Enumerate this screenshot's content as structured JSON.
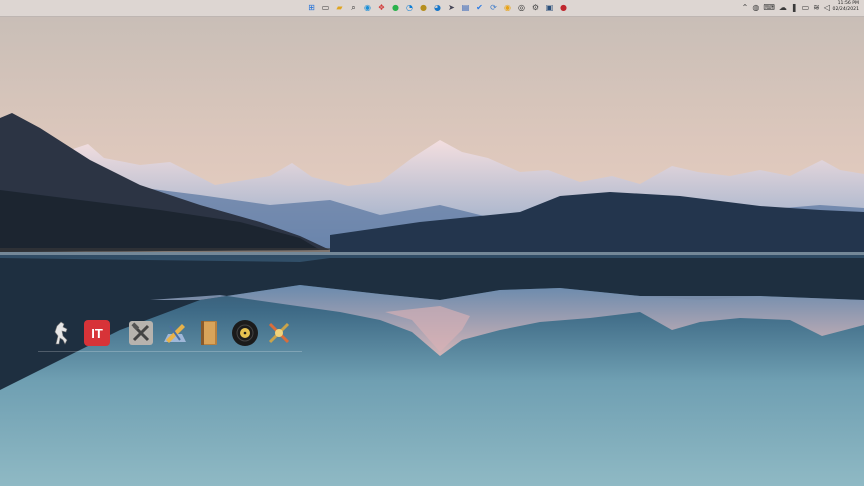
{
  "clock": {
    "time": "11:56 PM",
    "date": "02/24/2021"
  },
  "taskbar": {
    "apps": [
      {
        "name": "start-icon",
        "glyph": "⊞",
        "color": "#1e6fd9"
      },
      {
        "name": "task-view-icon",
        "glyph": "▭",
        "color": "#3a3a3a"
      },
      {
        "name": "file-explorer-icon",
        "glyph": "▰",
        "color": "#e0a520"
      },
      {
        "name": "search-icon",
        "glyph": "⌕",
        "color": "#2e2e2e"
      },
      {
        "name": "chrome-icon",
        "glyph": "◉",
        "color": "#1b8fd8"
      },
      {
        "name": "photos-icon",
        "glyph": "❖",
        "color": "#d23b3b"
      },
      {
        "name": "evernote-icon",
        "glyph": "●",
        "color": "#2bb24c"
      },
      {
        "name": "edge-icon",
        "glyph": "◔",
        "color": "#0a7cd5"
      },
      {
        "name": "headset-icon",
        "glyph": "●",
        "color": "#b68f1e"
      },
      {
        "name": "edge-dev-icon",
        "glyph": "◕",
        "color": "#1877c9"
      },
      {
        "name": "rocket-icon",
        "glyph": "➤",
        "color": "#445"
      },
      {
        "name": "word-icon",
        "glyph": "▤",
        "color": "#2b5fb8"
      },
      {
        "name": "todo-icon",
        "glyph": "✔",
        "color": "#2c7be5"
      },
      {
        "name": "sync-icon",
        "glyph": "⟳",
        "color": "#3677c9"
      },
      {
        "name": "chrome-canary-icon",
        "glyph": "◉",
        "color": "#e8a317"
      },
      {
        "name": "circle-app-icon",
        "glyph": "◎",
        "color": "#2f2f2f"
      },
      {
        "name": "settings-icon",
        "glyph": "⚙",
        "color": "#4a4a4a"
      },
      {
        "name": "video-icon",
        "glyph": "▣",
        "color": "#2a4f7a"
      },
      {
        "name": "record-icon",
        "glyph": "●",
        "color": "#c0262d"
      }
    ],
    "tray": [
      {
        "name": "chevron-up-icon",
        "glyph": "⌃"
      },
      {
        "name": "antivirus-icon",
        "glyph": "◍"
      },
      {
        "name": "keyboard-icon",
        "glyph": "⌨"
      },
      {
        "name": "cloud-icon",
        "glyph": "☁"
      },
      {
        "name": "microphone-icon",
        "glyph": "❚"
      },
      {
        "name": "display-icon",
        "glyph": "▭"
      },
      {
        "name": "wifi-icon",
        "glyph": "≋"
      },
      {
        "name": "volume-icon",
        "glyph": "◁"
      }
    ]
  },
  "dock": {
    "items": [
      {
        "name": "horse-app-icon"
      },
      {
        "name": "it-app-icon",
        "label": "IT",
        "color": "#d73338"
      },
      {
        "name": "tools-app-icon"
      },
      {
        "name": "xcode-app-icon"
      },
      {
        "name": "book-app-icon"
      },
      {
        "name": "vinyl-app-icon"
      },
      {
        "name": "utility-app-icon"
      }
    ]
  }
}
